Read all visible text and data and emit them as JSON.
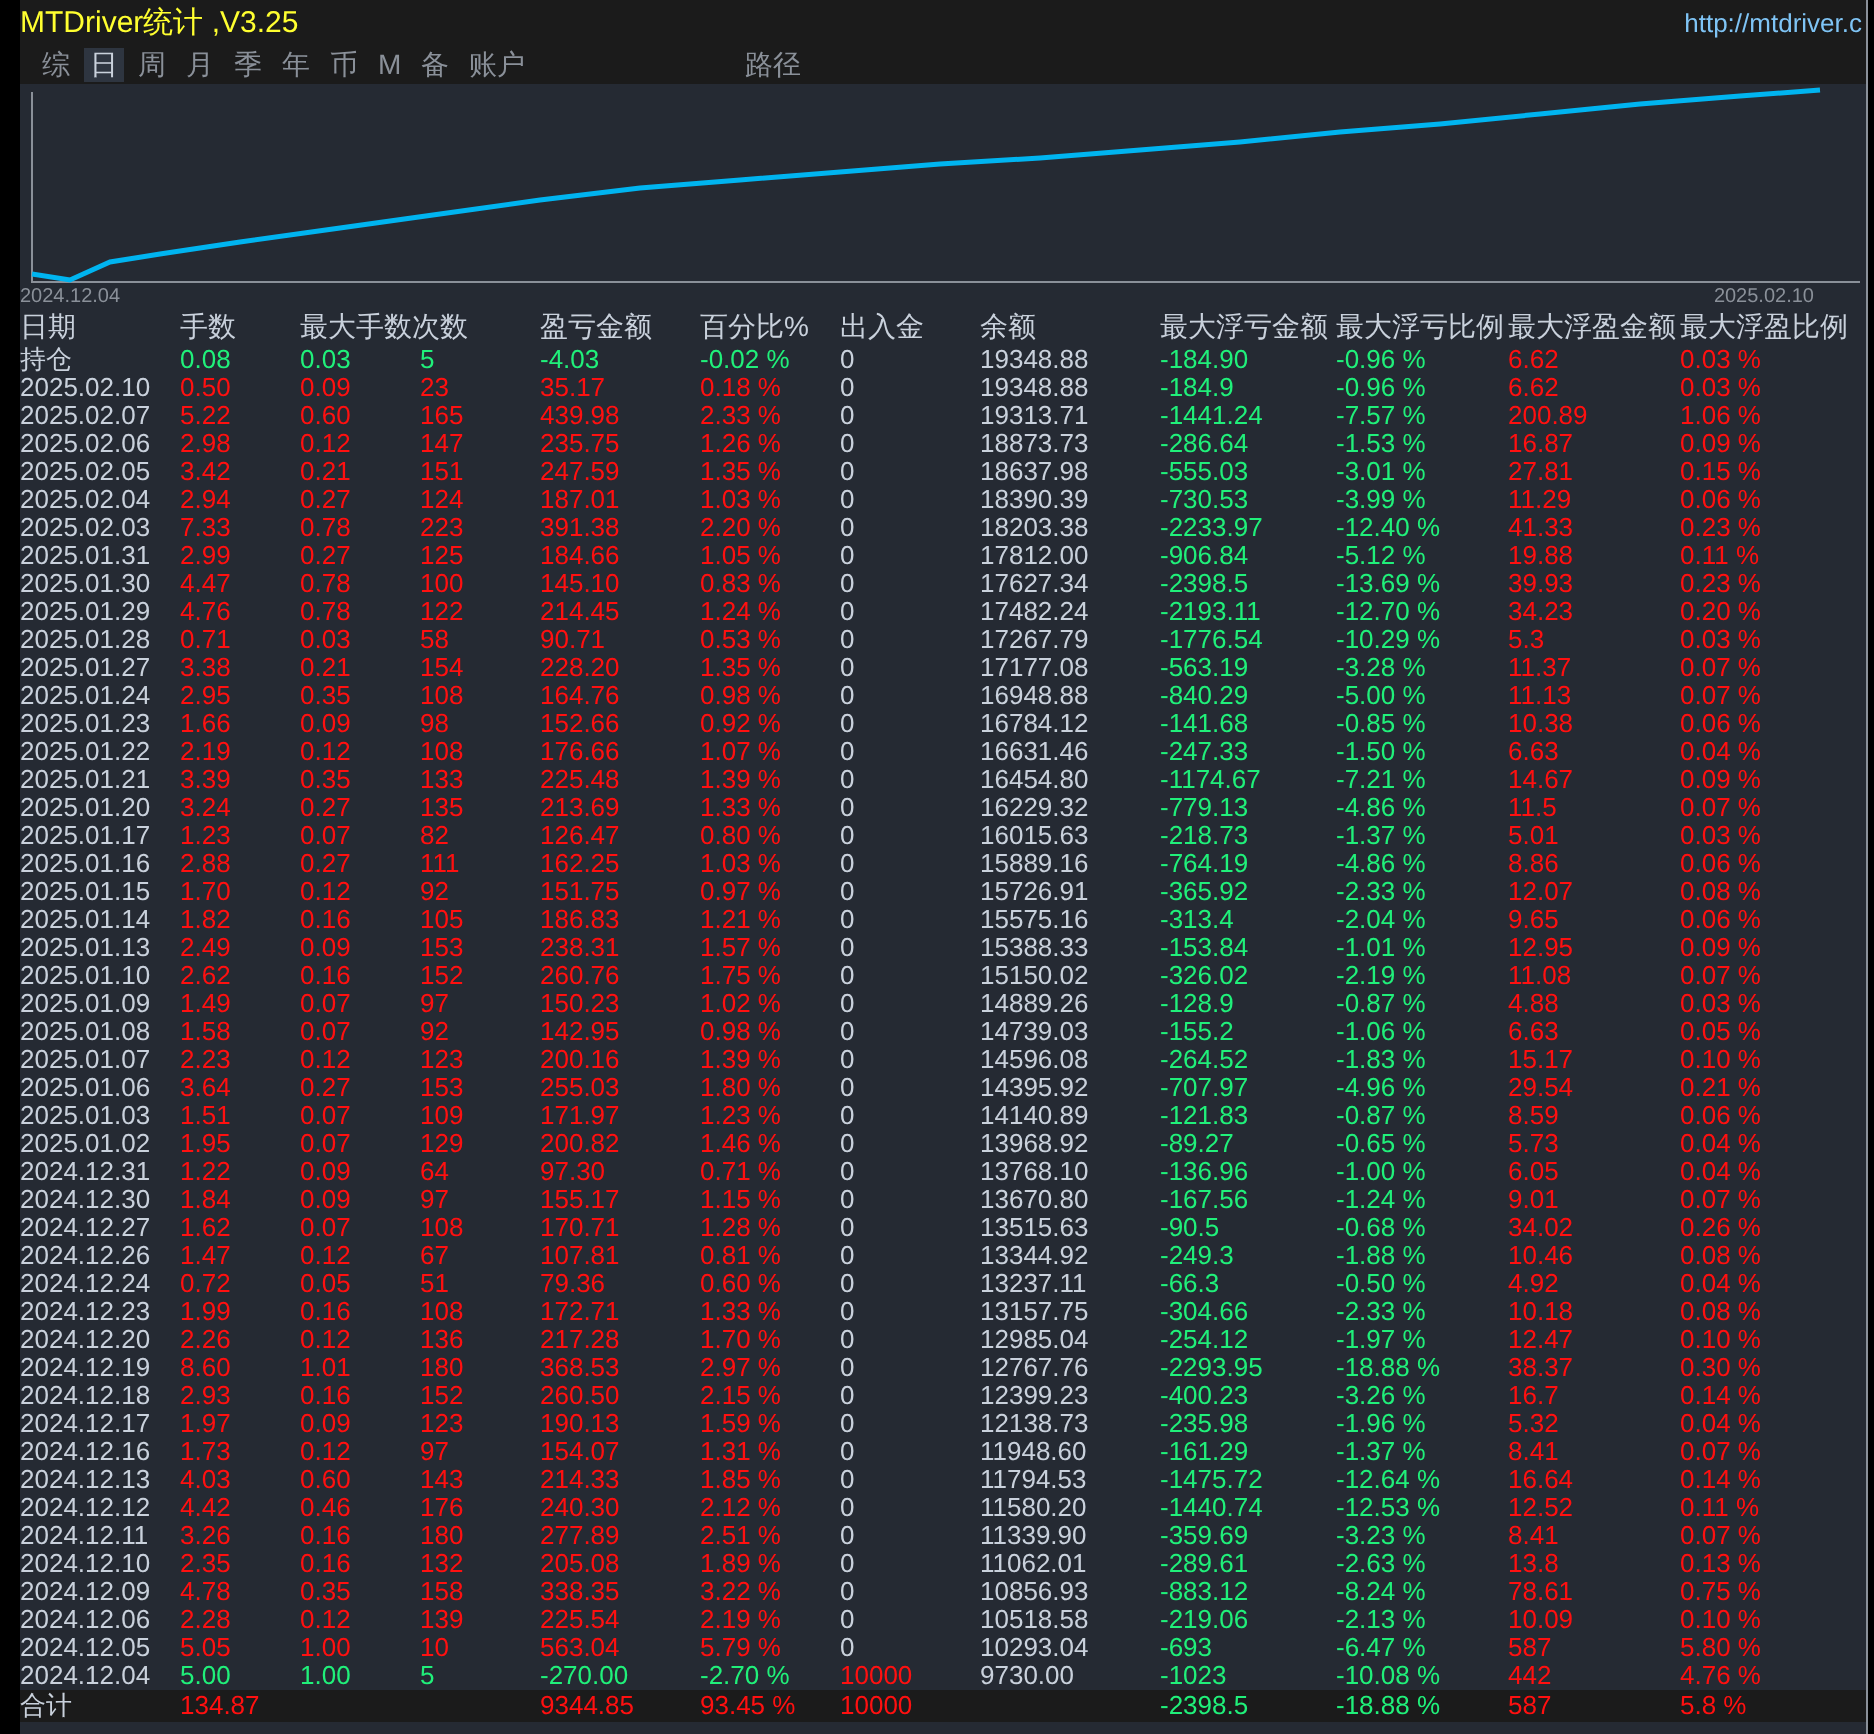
{
  "window": {
    "title": "MTDriver统计 ,V3.25",
    "url": "http://mtdriver.c"
  },
  "tabs": [
    {
      "label": "综",
      "selected": false
    },
    {
      "label": "日",
      "selected": true
    },
    {
      "label": "周",
      "selected": false
    },
    {
      "label": "月",
      "selected": false
    },
    {
      "label": "季",
      "selected": false
    },
    {
      "label": "年",
      "selected": false
    },
    {
      "label": "币",
      "selected": false
    },
    {
      "label": "M",
      "selected": false
    },
    {
      "label": "备",
      "selected": false
    },
    {
      "label": "账户",
      "selected": false
    },
    {
      "label": "路径",
      "selected": false
    }
  ],
  "chart": {
    "start_label": "2024.12.04",
    "end_label": "2025.02.10"
  },
  "table": {
    "columns": [
      "日期",
      "手数",
      "最大手数次数",
      "盈亏金额",
      "百分比%",
      "出入金",
      "余额",
      "最大浮亏金额",
      "最大浮亏比例",
      "最大浮盈金额",
      "最大浮盈比例"
    ],
    "rows": [
      {
        "cells": [
          "持仓",
          "0.08",
          [
            "0.03",
            "5"
          ],
          "-4.03",
          "-0.02 %",
          "0",
          "19348.88",
          "-184.90",
          "-0.96 %",
          "6.62",
          "0.03 %"
        ],
        "loss": true,
        "deposit": false
      },
      {
        "cells": [
          "2025.02.10",
          "0.50",
          [
            "0.09",
            "23"
          ],
          "35.17",
          "0.18 %",
          "0",
          "19348.88",
          "-184.9",
          "-0.96 %",
          "6.62",
          "0.03 %"
        ],
        "loss": false,
        "deposit": false
      },
      {
        "cells": [
          "2025.02.07",
          "5.22",
          [
            "0.60",
            "165"
          ],
          "439.98",
          "2.33 %",
          "0",
          "19313.71",
          "-1441.24",
          "-7.57 %",
          "200.89",
          "1.06 %"
        ],
        "loss": false,
        "deposit": false
      },
      {
        "cells": [
          "2025.02.06",
          "2.98",
          [
            "0.12",
            "147"
          ],
          "235.75",
          "1.26 %",
          "0",
          "18873.73",
          "-286.64",
          "-1.53 %",
          "16.87",
          "0.09 %"
        ],
        "loss": false,
        "deposit": false
      },
      {
        "cells": [
          "2025.02.05",
          "3.42",
          [
            "0.21",
            "151"
          ],
          "247.59",
          "1.35 %",
          "0",
          "18637.98",
          "-555.03",
          "-3.01 %",
          "27.81",
          "0.15 %"
        ],
        "loss": false,
        "deposit": false
      },
      {
        "cells": [
          "2025.02.04",
          "2.94",
          [
            "0.27",
            "124"
          ],
          "187.01",
          "1.03 %",
          "0",
          "18390.39",
          "-730.53",
          "-3.99 %",
          "11.29",
          "0.06 %"
        ],
        "loss": false,
        "deposit": false
      },
      {
        "cells": [
          "2025.02.03",
          "7.33",
          [
            "0.78",
            "223"
          ],
          "391.38",
          "2.20 %",
          "0",
          "18203.38",
          "-2233.97",
          "-12.40 %",
          "41.33",
          "0.23 %"
        ],
        "loss": false,
        "deposit": false
      },
      {
        "cells": [
          "2025.01.31",
          "2.99",
          [
            "0.27",
            "125"
          ],
          "184.66",
          "1.05 %",
          "0",
          "17812.00",
          "-906.84",
          "-5.12 %",
          "19.88",
          "0.11 %"
        ],
        "loss": false,
        "deposit": false
      },
      {
        "cells": [
          "2025.01.30",
          "4.47",
          [
            "0.78",
            "100"
          ],
          "145.10",
          "0.83 %",
          "0",
          "17627.34",
          "-2398.5",
          "-13.69 %",
          "39.93",
          "0.23 %"
        ],
        "loss": false,
        "deposit": false
      },
      {
        "cells": [
          "2025.01.29",
          "4.76",
          [
            "0.78",
            "122"
          ],
          "214.45",
          "1.24 %",
          "0",
          "17482.24",
          "-2193.11",
          "-12.70 %",
          "34.23",
          "0.20 %"
        ],
        "loss": false,
        "deposit": false
      },
      {
        "cells": [
          "2025.01.28",
          "0.71",
          [
            "0.03",
            "58"
          ],
          "90.71",
          "0.53 %",
          "0",
          "17267.79",
          "-1776.54",
          "-10.29 %",
          "5.3",
          "0.03 %"
        ],
        "loss": false,
        "deposit": false
      },
      {
        "cells": [
          "2025.01.27",
          "3.38",
          [
            "0.21",
            "154"
          ],
          "228.20",
          "1.35 %",
          "0",
          "17177.08",
          "-563.19",
          "-3.28 %",
          "11.37",
          "0.07 %"
        ],
        "loss": false,
        "deposit": false
      },
      {
        "cells": [
          "2025.01.24",
          "2.95",
          [
            "0.35",
            "108"
          ],
          "164.76",
          "0.98 %",
          "0",
          "16948.88",
          "-840.29",
          "-5.00 %",
          "11.13",
          "0.07 %"
        ],
        "loss": false,
        "deposit": false
      },
      {
        "cells": [
          "2025.01.23",
          "1.66",
          [
            "0.09",
            "98"
          ],
          "152.66",
          "0.92 %",
          "0",
          "16784.12",
          "-141.68",
          "-0.85 %",
          "10.38",
          "0.06 %"
        ],
        "loss": false,
        "deposit": false
      },
      {
        "cells": [
          "2025.01.22",
          "2.19",
          [
            "0.12",
            "108"
          ],
          "176.66",
          "1.07 %",
          "0",
          "16631.46",
          "-247.33",
          "-1.50 %",
          "6.63",
          "0.04 %"
        ],
        "loss": false,
        "deposit": false
      },
      {
        "cells": [
          "2025.01.21",
          "3.39",
          [
            "0.35",
            "133"
          ],
          "225.48",
          "1.39 %",
          "0",
          "16454.80",
          "-1174.67",
          "-7.21 %",
          "14.67",
          "0.09 %"
        ],
        "loss": false,
        "deposit": false
      },
      {
        "cells": [
          "2025.01.20",
          "3.24",
          [
            "0.27",
            "135"
          ],
          "213.69",
          "1.33 %",
          "0",
          "16229.32",
          "-779.13",
          "-4.86 %",
          "11.5",
          "0.07 %"
        ],
        "loss": false,
        "deposit": false
      },
      {
        "cells": [
          "2025.01.17",
          "1.23",
          [
            "0.07",
            "82"
          ],
          "126.47",
          "0.80 %",
          "0",
          "16015.63",
          "-218.73",
          "-1.37 %",
          "5.01",
          "0.03 %"
        ],
        "loss": false,
        "deposit": false
      },
      {
        "cells": [
          "2025.01.16",
          "2.88",
          [
            "0.27",
            "111"
          ],
          "162.25",
          "1.03 %",
          "0",
          "15889.16",
          "-764.19",
          "-4.86 %",
          "8.86",
          "0.06 %"
        ],
        "loss": false,
        "deposit": false
      },
      {
        "cells": [
          "2025.01.15",
          "1.70",
          [
            "0.12",
            "92"
          ],
          "151.75",
          "0.97 %",
          "0",
          "15726.91",
          "-365.92",
          "-2.33 %",
          "12.07",
          "0.08 %"
        ],
        "loss": false,
        "deposit": false
      },
      {
        "cells": [
          "2025.01.14",
          "1.82",
          [
            "0.16",
            "105"
          ],
          "186.83",
          "1.21 %",
          "0",
          "15575.16",
          "-313.4",
          "-2.04 %",
          "9.65",
          "0.06 %"
        ],
        "loss": false,
        "deposit": false
      },
      {
        "cells": [
          "2025.01.13",
          "2.49",
          [
            "0.09",
            "153"
          ],
          "238.31",
          "1.57 %",
          "0",
          "15388.33",
          "-153.84",
          "-1.01 %",
          "12.95",
          "0.09 %"
        ],
        "loss": false,
        "deposit": false
      },
      {
        "cells": [
          "2025.01.10",
          "2.62",
          [
            "0.16",
            "152"
          ],
          "260.76",
          "1.75 %",
          "0",
          "15150.02",
          "-326.02",
          "-2.19 %",
          "11.08",
          "0.07 %"
        ],
        "loss": false,
        "deposit": false
      },
      {
        "cells": [
          "2025.01.09",
          "1.49",
          [
            "0.07",
            "97"
          ],
          "150.23",
          "1.02 %",
          "0",
          "14889.26",
          "-128.9",
          "-0.87 %",
          "4.88",
          "0.03 %"
        ],
        "loss": false,
        "deposit": false
      },
      {
        "cells": [
          "2025.01.08",
          "1.58",
          [
            "0.07",
            "92"
          ],
          "142.95",
          "0.98 %",
          "0",
          "14739.03",
          "-155.2",
          "-1.06 %",
          "6.63",
          "0.05 %"
        ],
        "loss": false,
        "deposit": false
      },
      {
        "cells": [
          "2025.01.07",
          "2.23",
          [
            "0.12",
            "123"
          ],
          "200.16",
          "1.39 %",
          "0",
          "14596.08",
          "-264.52",
          "-1.83 %",
          "15.17",
          "0.10 %"
        ],
        "loss": false,
        "deposit": false
      },
      {
        "cells": [
          "2025.01.06",
          "3.64",
          [
            "0.27",
            "153"
          ],
          "255.03",
          "1.80 %",
          "0",
          "14395.92",
          "-707.97",
          "-4.96 %",
          "29.54",
          "0.21 %"
        ],
        "loss": false,
        "deposit": false
      },
      {
        "cells": [
          "2025.01.03",
          "1.51",
          [
            "0.07",
            "109"
          ],
          "171.97",
          "1.23 %",
          "0",
          "14140.89",
          "-121.83",
          "-0.87 %",
          "8.59",
          "0.06 %"
        ],
        "loss": false,
        "deposit": false
      },
      {
        "cells": [
          "2025.01.02",
          "1.95",
          [
            "0.07",
            "129"
          ],
          "200.82",
          "1.46 %",
          "0",
          "13968.92",
          "-89.27",
          "-0.65 %",
          "5.73",
          "0.04 %"
        ],
        "loss": false,
        "deposit": false
      },
      {
        "cells": [
          "2024.12.31",
          "1.22",
          [
            "0.09",
            "64"
          ],
          "97.30",
          "0.71 %",
          "0",
          "13768.10",
          "-136.96",
          "-1.00 %",
          "6.05",
          "0.04 %"
        ],
        "loss": false,
        "deposit": false
      },
      {
        "cells": [
          "2024.12.30",
          "1.84",
          [
            "0.09",
            "97"
          ],
          "155.17",
          "1.15 %",
          "0",
          "13670.80",
          "-167.56",
          "-1.24 %",
          "9.01",
          "0.07 %"
        ],
        "loss": false,
        "deposit": false
      },
      {
        "cells": [
          "2024.12.27",
          "1.62",
          [
            "0.07",
            "108"
          ],
          "170.71",
          "1.28 %",
          "0",
          "13515.63",
          "-90.5",
          "-0.68 %",
          "34.02",
          "0.26 %"
        ],
        "loss": false,
        "deposit": false
      },
      {
        "cells": [
          "2024.12.26",
          "1.47",
          [
            "0.12",
            "67"
          ],
          "107.81",
          "0.81 %",
          "0",
          "13344.92",
          "-249.3",
          "-1.88 %",
          "10.46",
          "0.08 %"
        ],
        "loss": false,
        "deposit": false
      },
      {
        "cells": [
          "2024.12.24",
          "0.72",
          [
            "0.05",
            "51"
          ],
          "79.36",
          "0.60 %",
          "0",
          "13237.11",
          "-66.3",
          "-0.50 %",
          "4.92",
          "0.04 %"
        ],
        "loss": false,
        "deposit": false
      },
      {
        "cells": [
          "2024.12.23",
          "1.99",
          [
            "0.16",
            "108"
          ],
          "172.71",
          "1.33 %",
          "0",
          "13157.75",
          "-304.66",
          "-2.33 %",
          "10.18",
          "0.08 %"
        ],
        "loss": false,
        "deposit": false
      },
      {
        "cells": [
          "2024.12.20",
          "2.26",
          [
            "0.12",
            "136"
          ],
          "217.28",
          "1.70 %",
          "0",
          "12985.04",
          "-254.12",
          "-1.97 %",
          "12.47",
          "0.10 %"
        ],
        "loss": false,
        "deposit": false
      },
      {
        "cells": [
          "2024.12.19",
          "8.60",
          [
            "1.01",
            "180"
          ],
          "368.53",
          "2.97 %",
          "0",
          "12767.76",
          "-2293.95",
          "-18.88 %",
          "38.37",
          "0.30 %"
        ],
        "loss": false,
        "deposit": false
      },
      {
        "cells": [
          "2024.12.18",
          "2.93",
          [
            "0.16",
            "152"
          ],
          "260.50",
          "2.15 %",
          "0",
          "12399.23",
          "-400.23",
          "-3.26 %",
          "16.7",
          "0.14 %"
        ],
        "loss": false,
        "deposit": false
      },
      {
        "cells": [
          "2024.12.17",
          "1.97",
          [
            "0.09",
            "123"
          ],
          "190.13",
          "1.59 %",
          "0",
          "12138.73",
          "-235.98",
          "-1.96 %",
          "5.32",
          "0.04 %"
        ],
        "loss": false,
        "deposit": false
      },
      {
        "cells": [
          "2024.12.16",
          "1.73",
          [
            "0.12",
            "97"
          ],
          "154.07",
          "1.31 %",
          "0",
          "11948.60",
          "-161.29",
          "-1.37 %",
          "8.41",
          "0.07 %"
        ],
        "loss": false,
        "deposit": false
      },
      {
        "cells": [
          "2024.12.13",
          "4.03",
          [
            "0.60",
            "143"
          ],
          "214.33",
          "1.85 %",
          "0",
          "11794.53",
          "-1475.72",
          "-12.64 %",
          "16.64",
          "0.14 %"
        ],
        "loss": false,
        "deposit": false
      },
      {
        "cells": [
          "2024.12.12",
          "4.42",
          [
            "0.46",
            "176"
          ],
          "240.30",
          "2.12 %",
          "0",
          "11580.20",
          "-1440.74",
          "-12.53 %",
          "12.52",
          "0.11 %"
        ],
        "loss": false,
        "deposit": false
      },
      {
        "cells": [
          "2024.12.11",
          "3.26",
          [
            "0.16",
            "180"
          ],
          "277.89",
          "2.51 %",
          "0",
          "11339.90",
          "-359.69",
          "-3.23 %",
          "8.41",
          "0.07 %"
        ],
        "loss": false,
        "deposit": false
      },
      {
        "cells": [
          "2024.12.10",
          "2.35",
          [
            "0.16",
            "132"
          ],
          "205.08",
          "1.89 %",
          "0",
          "11062.01",
          "-289.61",
          "-2.63 %",
          "13.8",
          "0.13 %"
        ],
        "loss": false,
        "deposit": false
      },
      {
        "cells": [
          "2024.12.09",
          "4.78",
          [
            "0.35",
            "158"
          ],
          "338.35",
          "3.22 %",
          "0",
          "10856.93",
          "-883.12",
          "-8.24 %",
          "78.61",
          "0.75 %"
        ],
        "loss": false,
        "deposit": false
      },
      {
        "cells": [
          "2024.12.06",
          "2.28",
          [
            "0.12",
            "139"
          ],
          "225.54",
          "2.19 %",
          "0",
          "10518.58",
          "-219.06",
          "-2.13 %",
          "10.09",
          "0.10 %"
        ],
        "loss": false,
        "deposit": false
      },
      {
        "cells": [
          "2024.12.05",
          "5.05",
          [
            "1.00",
            "10"
          ],
          "563.04",
          "5.79 %",
          "0",
          "10293.04",
          "-693",
          "-6.47 %",
          "587",
          "5.80 %"
        ],
        "loss": false,
        "deposit": false
      },
      {
        "cells": [
          "2024.12.04",
          "5.00",
          [
            "1.00",
            "5"
          ],
          "-270.00",
          "-2.70 %",
          "10000",
          "9730.00",
          "-1023",
          "-10.08 %",
          "442",
          "4.76 %"
        ],
        "loss": true,
        "deposit": true
      }
    ],
    "total": {
      "label": "合计",
      "lots": "134.87",
      "pnl": "9344.85",
      "pct": "93.45 %",
      "inout": "10000",
      "max_loss": "-2398.5",
      "max_loss_pct": "-18.88 %",
      "max_profit": "587",
      "max_profit_pct": "5.8 %"
    }
  }
}
